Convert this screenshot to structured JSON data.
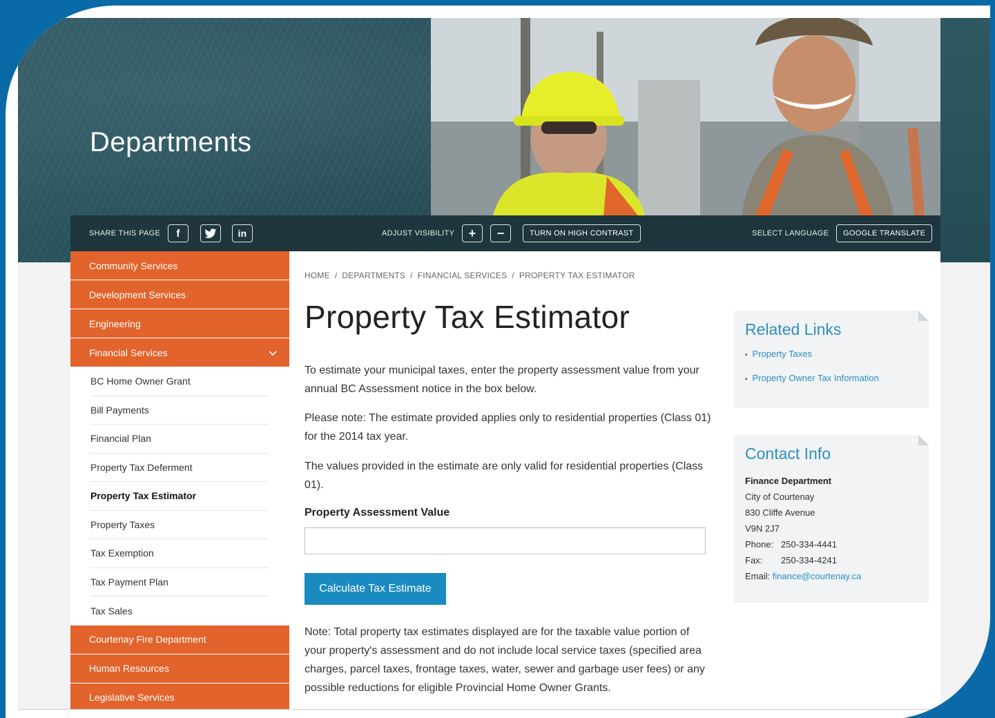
{
  "hero": {
    "title": "Departments"
  },
  "toolbar": {
    "share_label": "Share this page",
    "visibility_label": "Adjust visibility",
    "contrast_button": "Turn on high contrast",
    "language_label": "Select language",
    "translate_button": "Google Translate",
    "icons": [
      "facebook-icon",
      "twitter-icon",
      "linkedin-icon",
      "plus-icon",
      "minus-icon"
    ]
  },
  "sidebar": {
    "top_items": [
      {
        "label": "Community Services"
      },
      {
        "label": "Development Services"
      },
      {
        "label": "Engineering"
      },
      {
        "label": "Financial Services",
        "expanded": true
      }
    ],
    "sub_items": [
      {
        "label": "BC Home Owner Grant"
      },
      {
        "label": "Bill Payments"
      },
      {
        "label": "Financial Plan"
      },
      {
        "label": "Property Tax Deferment"
      },
      {
        "label": "Property Tax Estimator",
        "active": true
      },
      {
        "label": "Property Taxes"
      },
      {
        "label": "Tax Exemption"
      },
      {
        "label": "Tax Payment Plan"
      },
      {
        "label": "Tax Sales"
      }
    ],
    "bottom_items": [
      {
        "label": "Courtenay Fire Department"
      },
      {
        "label": "Human Resources"
      },
      {
        "label": "Legislative Services"
      }
    ]
  },
  "breadcrumb": [
    "Home",
    "Departments",
    "Financial Services",
    "Property Tax Estimator"
  ],
  "main": {
    "title": "Property Tax Estimator",
    "intro": "To estimate your municipal taxes, enter the property assessment value from your annual BC Assessment notice in the box below.",
    "note1": "Please note:  The estimate provided applies only to residential properties (Class 01) for the 2014 tax year.",
    "note2": "The values provided in the estimate are only valid for residential properties (Class 01).",
    "field_label": "Property Assessment Value",
    "field_value": "",
    "button_label": "Calculate Tax Estimate",
    "footer_note": "Note:  Total property tax estimates displayed are for the taxable value portion of your property's assessment and do not include local service taxes (specified area charges, parcel taxes, frontage taxes, water, sewer and garbage user fees) or any possible reductions for eligible Provincial Home Owner Grants."
  },
  "related_links": {
    "title": "Related Links",
    "links": [
      "Property Taxes",
      "Property Owner Tax Information"
    ]
  },
  "contact": {
    "title": "Contact Info",
    "department": "Finance Department",
    "org": "City of Courtenay",
    "address": "830 Cliffe Avenue",
    "postal": "V9N 2J7",
    "phone_label": "Phone:",
    "phone": "250-334-4441",
    "fax_label": "Fax:",
    "fax": "250-334-4241",
    "email_label": "Email:",
    "email": "finance@courtenay.ca"
  },
  "colors": {
    "frame_blue": "#0a6aa8",
    "nav_orange": "#e2632b",
    "accent_blue": "#1a8bc1",
    "hero_teal": "#2a5560"
  }
}
